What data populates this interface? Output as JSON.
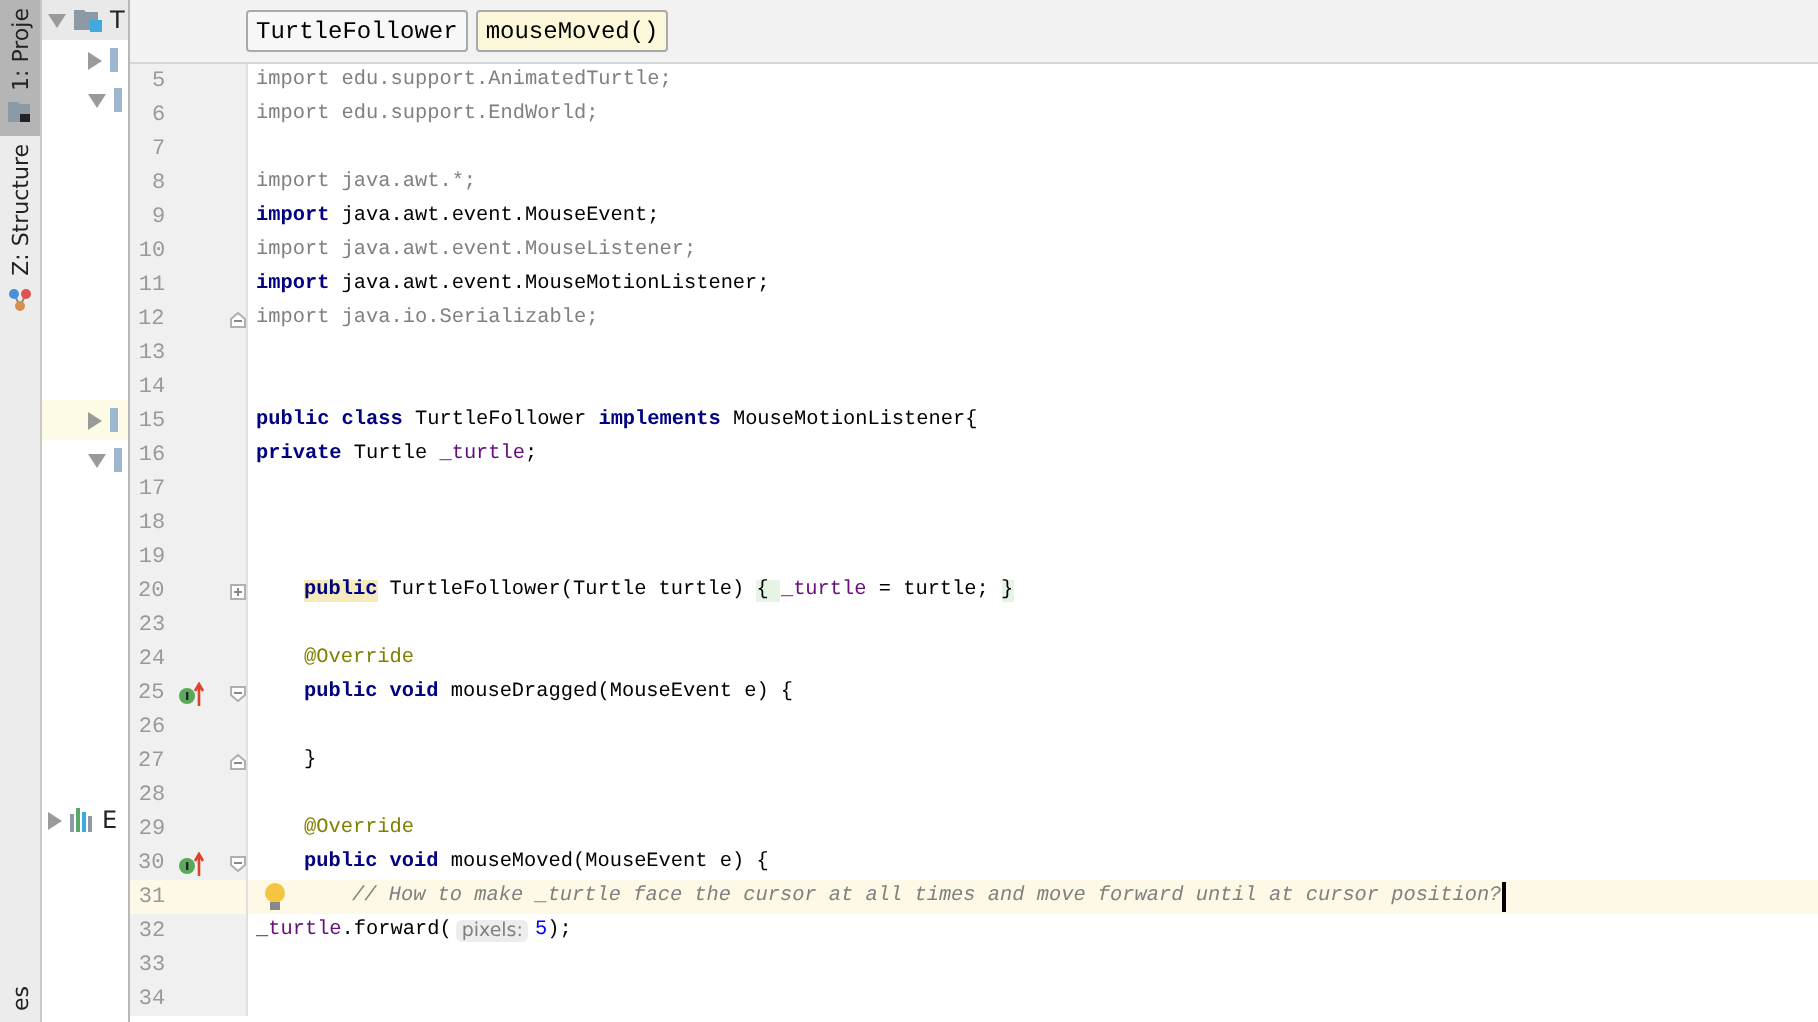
{
  "tool_strip": [
    {
      "label": "1: Proje",
      "selected": true,
      "kind": "folder"
    },
    {
      "label": "Z: Structure",
      "selected": false,
      "kind": "structure"
    },
    {
      "label": "es",
      "selected": false
    }
  ],
  "project_tree": [
    {
      "label": "T",
      "kind": "folder",
      "expanded": true,
      "selected": false,
      "children": [
        {
          "expanded": false,
          "selected": false
        },
        {
          "expanded": true,
          "selected": false
        },
        {
          "expanded": false,
          "selected": true
        },
        {
          "expanded": true,
          "selected": false
        }
      ]
    },
    {
      "label": "E",
      "kind": "chart",
      "expanded": false,
      "selected": false
    }
  ],
  "breadcrumbs": [
    {
      "label": "TurtleFollower",
      "selected": false
    },
    {
      "label": "mouseMoved()",
      "selected": true
    }
  ],
  "editor": {
    "lines": [
      {
        "number": "5",
        "kind": "top",
        "tokens": [
          {
            "kind": "unused",
            "text": "import edu.support.AnimatedTurtle;"
          }
        ]
      },
      {
        "number": "6",
        "kind": "top",
        "tokens": [
          {
            "kind": "unused",
            "text": "import edu.support.EndWorld;"
          }
        ]
      },
      {
        "number": "7",
        "kind": "top"
      },
      {
        "number": "8",
        "kind": "top",
        "tokens": [
          {
            "kind": "unused",
            "text": "import java.awt.*;"
          }
        ]
      },
      {
        "number": "9",
        "kind": "top",
        "tokens": [
          {
            "kind": "keyword",
            "text": "import"
          },
          {
            "kind": "plain",
            "text": " java.awt.event.MouseEvent;"
          }
        ]
      },
      {
        "number": "10",
        "kind": "top",
        "tokens": [
          {
            "kind": "unused",
            "text": "import java.awt.event.MouseListener;"
          }
        ]
      },
      {
        "number": "11",
        "kind": "top",
        "tokens": [
          {
            "kind": "keyword",
            "text": "import"
          },
          {
            "kind": "plain",
            "text": " java.awt.event.MouseMotionListener;"
          }
        ]
      },
      {
        "number": "12",
        "kind": "top",
        "fold": {
          "kind": "end"
        },
        "tokens": [
          {
            "kind": "unused",
            "text": "import java.io.Serializable;"
          }
        ]
      },
      {
        "number": "13",
        "kind": "top"
      },
      {
        "number": "14",
        "kind": "top"
      },
      {
        "number": "15",
        "kind": "top",
        "tokens": [
          {
            "kind": "keyword",
            "text": "public class"
          },
          {
            "kind": "plain",
            "text": " TurtleFollower "
          },
          {
            "kind": "keyword",
            "text": "implements"
          },
          {
            "kind": "plain",
            "text": " MouseMotionListener{"
          }
        ]
      },
      {
        "number": "16",
        "kind": "top",
        "tokens": [
          {
            "kind": "keyword",
            "text": "private"
          },
          {
            "kind": "plain",
            "text": " Turtle "
          },
          {
            "kind": "field",
            "text": "_turtle"
          },
          {
            "kind": "plain",
            "text": ";"
          }
        ]
      },
      {
        "number": "17",
        "kind": "top"
      },
      {
        "number": "18",
        "kind": "top"
      },
      {
        "number": "19",
        "kind": "top"
      },
      {
        "number": "20",
        "kind": "member",
        "fold": {
          "kind": "collapsed"
        },
        "tokens": [
          {
            "kind": "highlight",
            "text": "public"
          },
          {
            "kind": "plain",
            "text": " TurtleFollower(Turtle turtle) "
          },
          {
            "kind": "folded",
            "text": "{ "
          },
          {
            "kind": "field",
            "text": "_turtle"
          },
          {
            "kind": "plain",
            "text": " = turtle; "
          },
          {
            "kind": "folded",
            "text": "}"
          }
        ]
      },
      {
        "number": "23",
        "kind": "member"
      },
      {
        "number": "24",
        "kind": "member",
        "tokens": [
          {
            "kind": "annotation",
            "text": "@Override"
          }
        ]
      },
      {
        "number": "25",
        "kind": "member",
        "marker": true,
        "fold": {
          "kind": "start"
        },
        "tokens": [
          {
            "kind": "keyword",
            "text": "public void"
          },
          {
            "kind": "plain",
            "text": " mouseDragged(MouseEvent e) {"
          }
        ]
      },
      {
        "number": "26",
        "kind": "member"
      },
      {
        "number": "27",
        "kind": "member",
        "fold": {
          "kind": "end"
        },
        "tokens": [
          {
            "kind": "plain",
            "text": "}"
          }
        ]
      },
      {
        "number": "28",
        "kind": "member"
      },
      {
        "number": "29",
        "kind": "member",
        "tokens": [
          {
            "kind": "annotation",
            "text": "@Override"
          }
        ]
      },
      {
        "number": "30",
        "kind": "member",
        "marker": true,
        "fold": {
          "kind": "start"
        },
        "tokens": [
          {
            "kind": "keyword",
            "text": "public void"
          },
          {
            "kind": "plain",
            "text": " mouseMoved(MouseEvent e) {"
          }
        ]
      },
      {
        "number": "31",
        "kind": "body",
        "current": true,
        "bulb": true,
        "tokens": [
          {
            "kind": "comment",
            "text": "// How to make _turtle face the cursor at all times and move forward until at cursor position?"
          }
        ]
      },
      {
        "number": "32",
        "kind": "top",
        "tokens": [
          {
            "kind": "field",
            "text": "_turtle"
          },
          {
            "kind": "plain",
            "text": ".forward("
          },
          {
            "kind": "hint",
            "text": "pixels:"
          },
          {
            "kind": "number",
            "text": "5"
          },
          {
            "kind": "plain",
            "text": ");"
          }
        ]
      },
      {
        "number": "33",
        "kind": "top"
      },
      {
        "number": "34",
        "kind": "top"
      }
    ]
  }
}
